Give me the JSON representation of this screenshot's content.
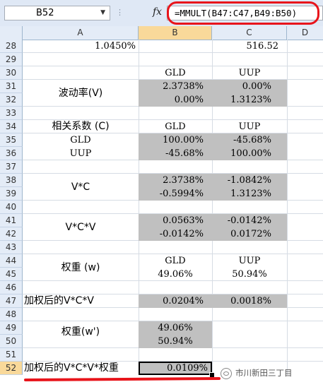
{
  "formula_bar": {
    "name_box": "B52",
    "fx_symbol": "fx",
    "formula": "=MMULT(B47:C47,B49:B50)"
  },
  "columns": [
    "A",
    "B",
    "C",
    "D"
  ],
  "rows": {
    "r28": {
      "num": "28",
      "a": "1.0450%",
      "c": "516.52"
    },
    "r29": {
      "num": "29"
    },
    "r30": {
      "num": "30",
      "b": "GLD",
      "c": "UUP"
    },
    "r31": {
      "num": "31",
      "b": "2.3738%",
      "c": "0.00%"
    },
    "r32": {
      "num": "32",
      "b": "0.00%",
      "c": "1.3123%"
    },
    "r33": {
      "num": "33"
    },
    "r34": {
      "num": "34",
      "a": "相关系数 (C)",
      "b": "GLD",
      "c": "UUP"
    },
    "r35": {
      "num": "35",
      "a": "GLD",
      "b": "100.00%",
      "c": "-45.68%"
    },
    "r36": {
      "num": "36",
      "a": "UUP",
      "b": "-45.68%",
      "c": "100.00%"
    },
    "r37": {
      "num": "37"
    },
    "r38": {
      "num": "38",
      "b": "2.3738%",
      "c": "-1.0842%"
    },
    "r39": {
      "num": "39",
      "b": "-0.5994%",
      "c": "1.3123%"
    },
    "r40": {
      "num": "40"
    },
    "r41": {
      "num": "41",
      "b": "0.0563%",
      "c": "-0.0142%"
    },
    "r42": {
      "num": "42",
      "b": "-0.0142%",
      "c": "0.0172%"
    },
    "r43": {
      "num": "43"
    },
    "r44": {
      "num": "44",
      "b": "GLD",
      "c": "UUP"
    },
    "r45": {
      "num": "45",
      "b": "49.06%",
      "c": "50.94%"
    },
    "r46": {
      "num": "46"
    },
    "r47": {
      "num": "47",
      "a": "加权后的V*C*V",
      "b": "0.0204%",
      "c": "0.0018%"
    },
    "r48": {
      "num": "48"
    },
    "r49": {
      "num": "49",
      "b": "49.06%"
    },
    "r50": {
      "num": "50",
      "b": "50.94%"
    },
    "r51": {
      "num": "51"
    },
    "r52": {
      "num": "52",
      "a": "加权后的V*C*V*权重",
      "b": "0.0109%"
    }
  },
  "merged_labels": {
    "volatility": "波动率(V)",
    "vc": "V*C",
    "vcv": "V*C*V",
    "weights": "权重 (w)",
    "weights_t": "权重(w')"
  },
  "watermark": "市川新田三丁目",
  "accent": "#e8141b"
}
